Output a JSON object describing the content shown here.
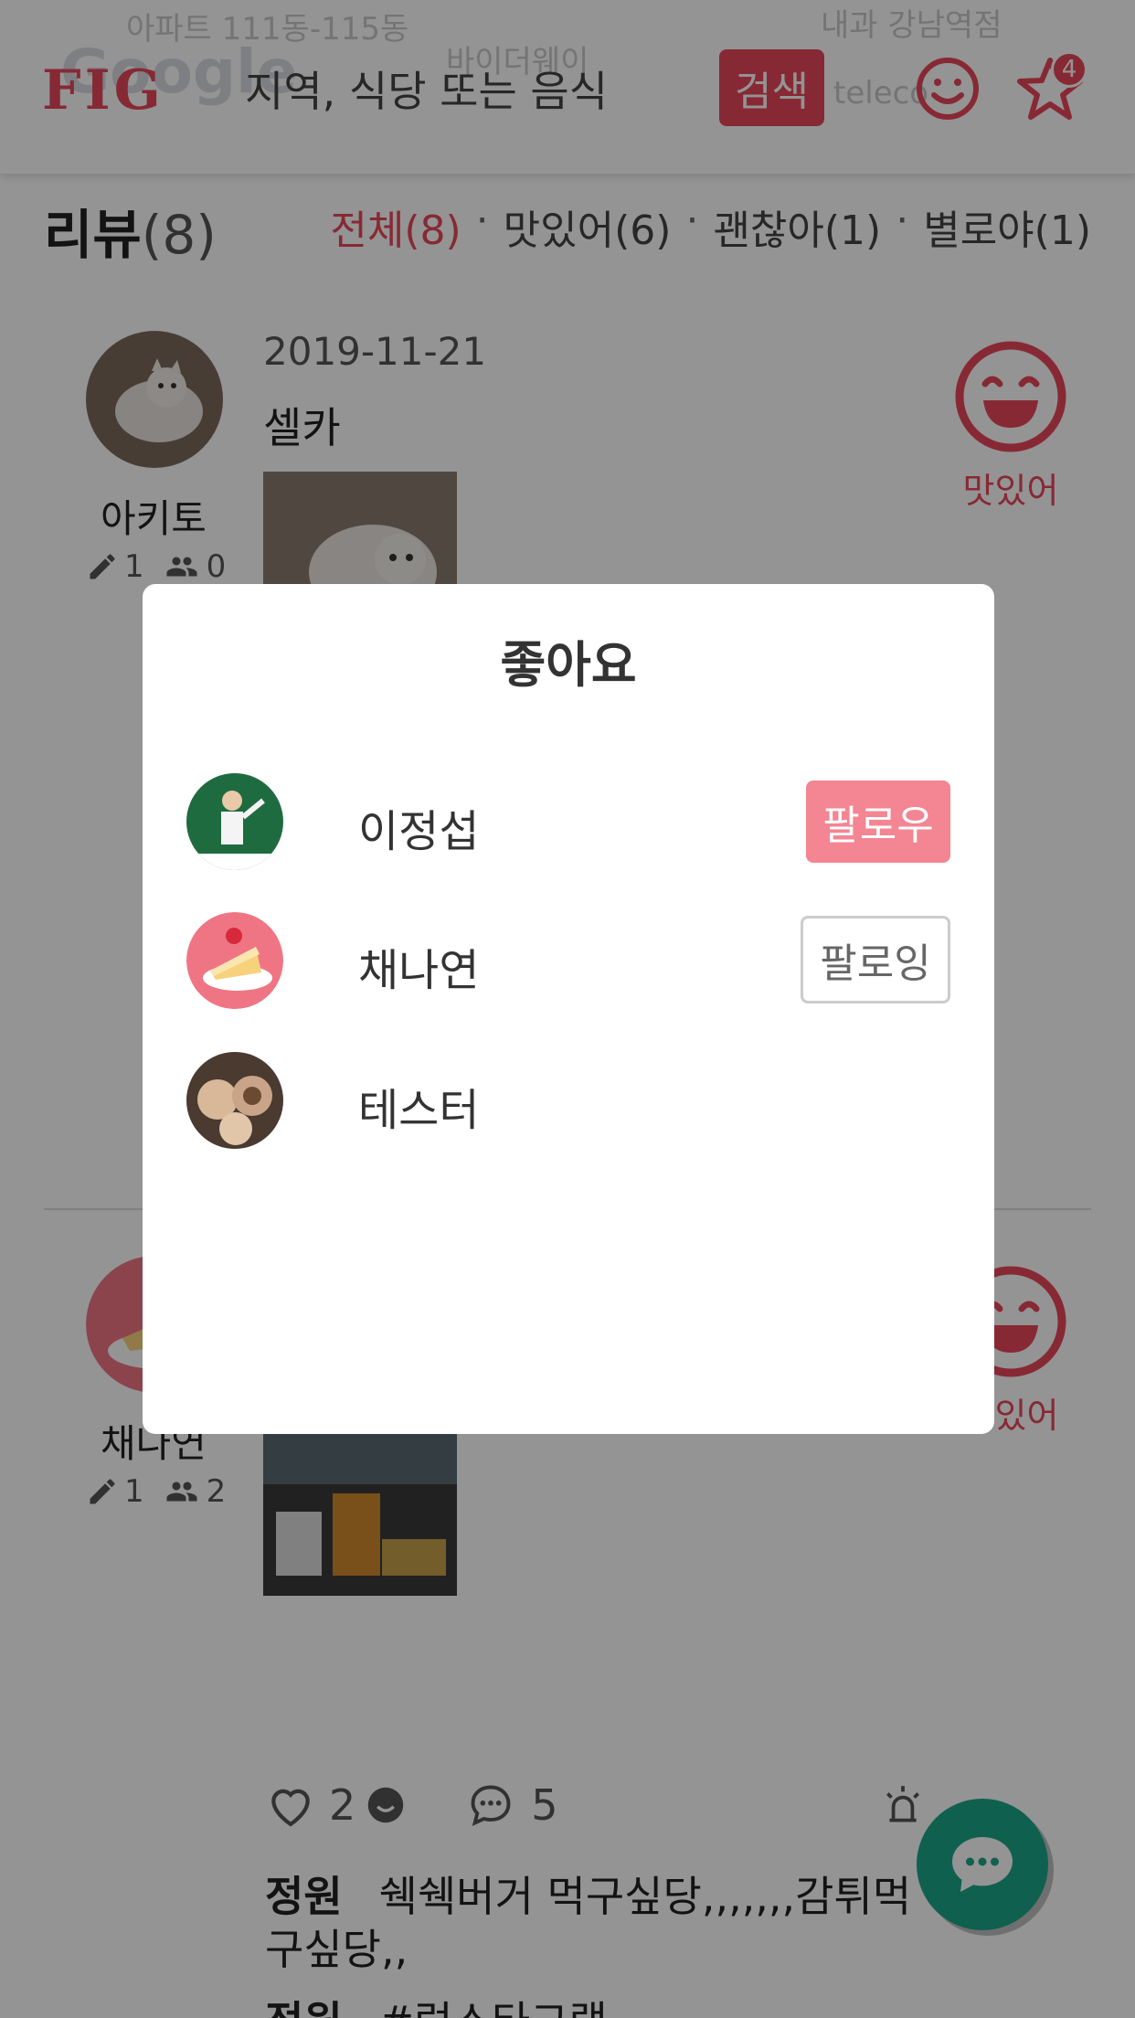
{
  "header": {
    "logo": "FIG",
    "search_placeholder": "지역, 식당 또는 음식",
    "search_button": "검색",
    "notification_count": "4",
    "map_labels": [
      "아파트 111동-115동",
      "바이더웨이",
      "내과 강남역점",
      "teleco",
      "Google"
    ]
  },
  "reviews_header": {
    "title": "리뷰",
    "count": "(8)",
    "filters": [
      {
        "label": "전체(8)",
        "active": true
      },
      {
        "label": "맛있어(6)",
        "active": false
      },
      {
        "label": "괜찮아(1)",
        "active": false
      },
      {
        "label": "별로야(1)",
        "active": false
      }
    ]
  },
  "review1": {
    "user_name": "아키토",
    "posts_count": "1",
    "followers_count": "0",
    "date": "2019-11-21",
    "text": "셀카",
    "rating_label": "맛있어"
  },
  "review2": {
    "user_name": "채나연",
    "posts_count": "1",
    "followers_count": "2",
    "rating_label": "맛있어",
    "likes_count": "2",
    "comments_count": "5",
    "comments": [
      {
        "author": "정원",
        "text": "쉑쉑버거 먹구싶당,,,,,,,감튀먹구싶당,,"
      },
      {
        "author": "정원",
        "text": "#럭스타그램"
      }
    ]
  },
  "likes_modal": {
    "title": "좋아요",
    "users": [
      {
        "name": "이정섭",
        "button": "팔로우",
        "state": "follow"
      },
      {
        "name": "채나연",
        "button": "팔로잉",
        "state": "following"
      },
      {
        "name": "테스터",
        "button": "",
        "state": "self"
      }
    ]
  },
  "colors": {
    "brand": "#e8475a",
    "follow": "#f48592",
    "fab": "#1da589"
  }
}
